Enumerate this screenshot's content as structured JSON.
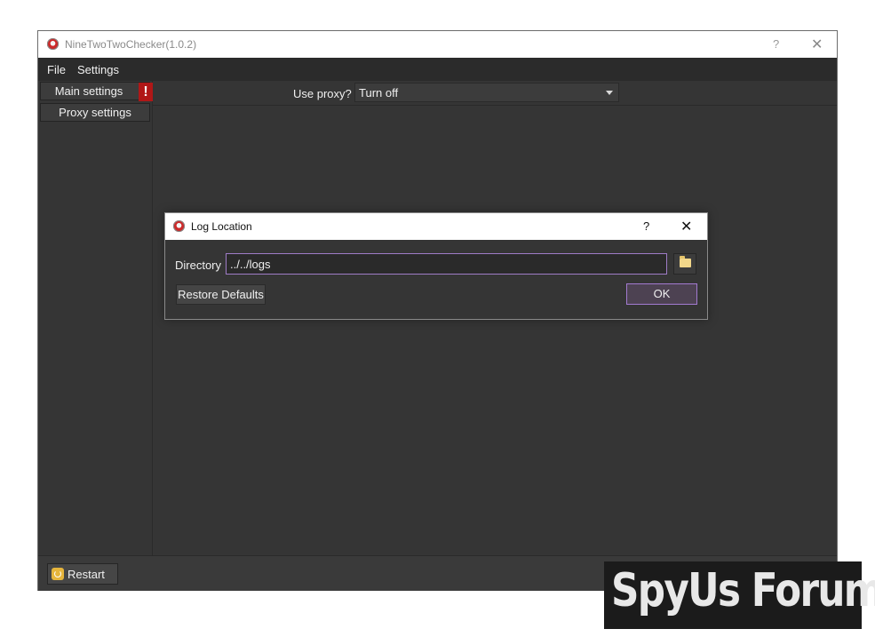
{
  "main_window": {
    "title": "NineTwoTwoChecker(1.0.2)",
    "help_glyph": "?",
    "close_glyph": "✕"
  },
  "menubar": {
    "items": [
      "File",
      "Settings"
    ]
  },
  "sidebar": {
    "items": [
      {
        "label": "Main settings",
        "alert": "!"
      },
      {
        "label": "Proxy settings"
      }
    ]
  },
  "proxy": {
    "label": "Use proxy?",
    "value": "Turn off"
  },
  "bottom_bar": {
    "restart_label": "Restart"
  },
  "dialog": {
    "title": "Log Location",
    "help_glyph": "?",
    "close_glyph": "✕",
    "directory_label": "Directory",
    "directory_value": "../../logs",
    "restore_label": "Restore Defaults",
    "ok_label": "OK"
  },
  "watermark": {
    "text": "SpyUs Forum"
  },
  "colors": {
    "accent": "#a27ad0",
    "window_bg": "#353535",
    "alert": "#b01717"
  }
}
